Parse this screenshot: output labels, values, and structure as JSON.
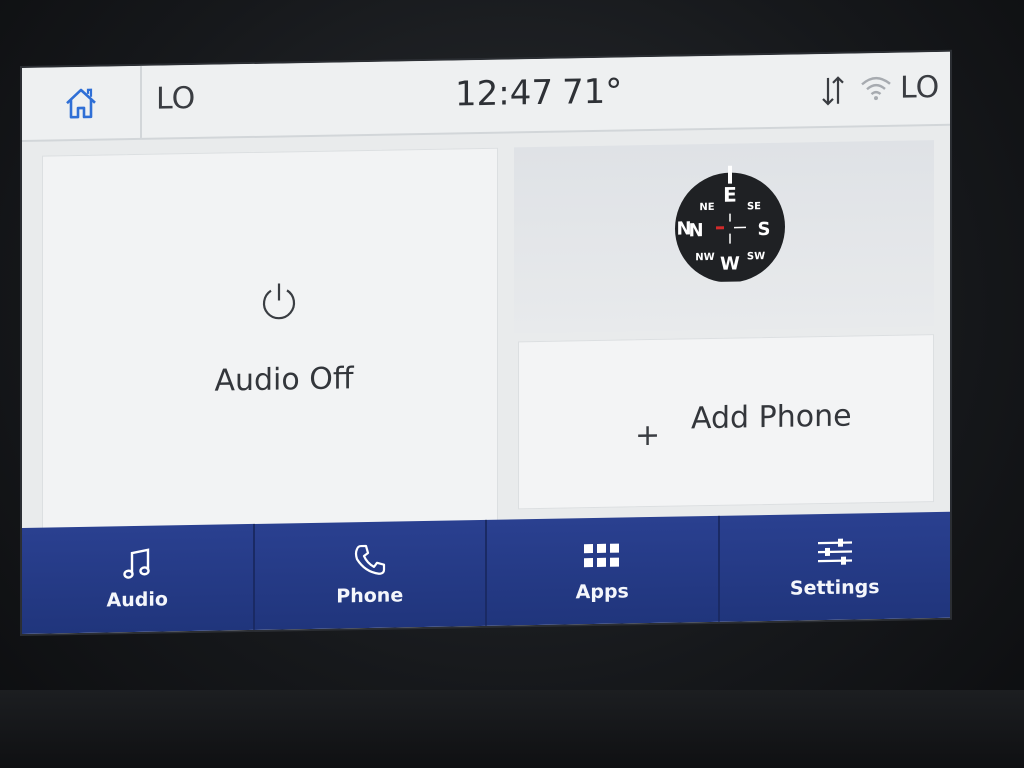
{
  "status_bar": {
    "driver_temp": "LO",
    "time": "12:47",
    "outside_temp": "71°",
    "passenger_temp": "LO"
  },
  "audio_tile": {
    "label": "Audio Off"
  },
  "compass_tile": {
    "directions": [
      "E",
      "S",
      "W",
      "N"
    ],
    "intercardinal": [
      "SE",
      "SW",
      "NW",
      "NE"
    ]
  },
  "phone_tile": {
    "plus": "+",
    "label": "Add Phone"
  },
  "nav": {
    "items": [
      {
        "label": "Audio",
        "icon": "music-note-icon"
      },
      {
        "label": "Phone",
        "icon": "phone-icon"
      },
      {
        "label": "Apps",
        "icon": "apps-grid-icon"
      },
      {
        "label": "Settings",
        "icon": "sliders-icon"
      }
    ]
  },
  "colors": {
    "nav_blue": "#24398a",
    "screen_bg": "#e9ebec",
    "accent_blue": "#2f6fd6"
  }
}
